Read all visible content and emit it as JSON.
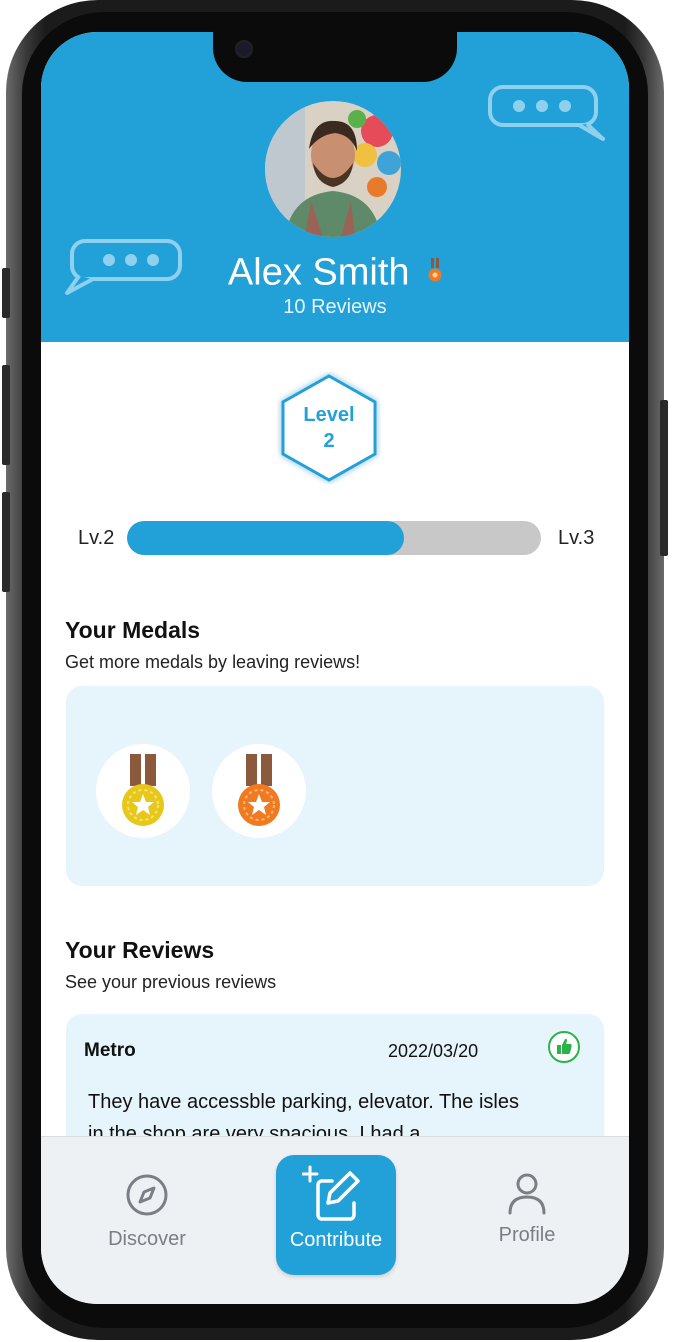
{
  "profile": {
    "name": "Alex Smith",
    "reviews_count": "10 Reviews"
  },
  "level": {
    "label": "Level",
    "value": "2",
    "progress_left": "Lv.2",
    "progress_right": "Lv.3",
    "progress_fraction": 0.67
  },
  "medals_section": {
    "title": "Your Medals",
    "subtitle": "Get more medals by leaving reviews!",
    "medals": [
      {
        "icon": "gold-star-medal-icon",
        "color": "#e7c81a"
      },
      {
        "icon": "bronze-star-medal-icon",
        "color": "#f07a1f"
      }
    ]
  },
  "reviews_section": {
    "title": "Your Reviews",
    "subtitle": "See your previous reviews",
    "reviews": [
      {
        "place": "Metro",
        "date": "2022/03/20",
        "rating_icon": "thumbs-up-icon",
        "text": "They have accessble parking, elevator. The isles in the shop are very spacious. I had a"
      }
    ]
  },
  "nav": {
    "discover": "Discover",
    "contribute": "Contribute",
    "profile": "Profile"
  },
  "colors": {
    "brand": "#22a0d8",
    "light_panel": "#e6f4fc",
    "thumb_green": "#2bb34a",
    "nav_bg": "#eef1f4"
  }
}
